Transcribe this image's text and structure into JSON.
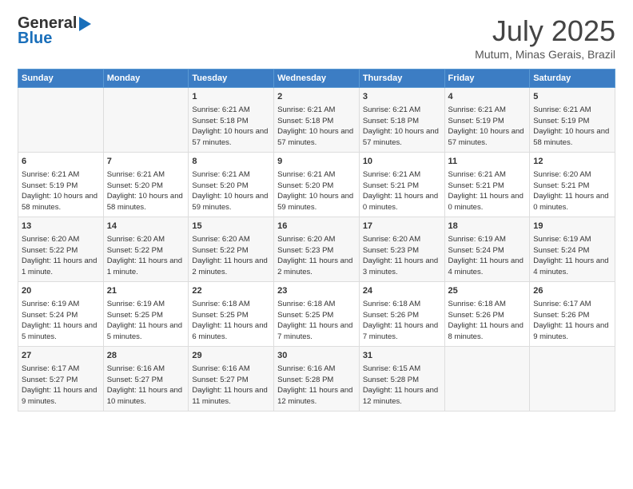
{
  "header": {
    "logo_general": "General",
    "logo_blue": "Blue",
    "month_year": "July 2025",
    "location": "Mutum, Minas Gerais, Brazil"
  },
  "days_of_week": [
    "Sunday",
    "Monday",
    "Tuesday",
    "Wednesday",
    "Thursday",
    "Friday",
    "Saturday"
  ],
  "weeks": [
    [
      {
        "day": "",
        "info": ""
      },
      {
        "day": "",
        "info": ""
      },
      {
        "day": "1",
        "info": "Sunrise: 6:21 AM\nSunset: 5:18 PM\nDaylight: 10 hours and 57 minutes."
      },
      {
        "day": "2",
        "info": "Sunrise: 6:21 AM\nSunset: 5:18 PM\nDaylight: 10 hours and 57 minutes."
      },
      {
        "day": "3",
        "info": "Sunrise: 6:21 AM\nSunset: 5:18 PM\nDaylight: 10 hours and 57 minutes."
      },
      {
        "day": "4",
        "info": "Sunrise: 6:21 AM\nSunset: 5:19 PM\nDaylight: 10 hours and 57 minutes."
      },
      {
        "day": "5",
        "info": "Sunrise: 6:21 AM\nSunset: 5:19 PM\nDaylight: 10 hours and 58 minutes."
      }
    ],
    [
      {
        "day": "6",
        "info": "Sunrise: 6:21 AM\nSunset: 5:19 PM\nDaylight: 10 hours and 58 minutes."
      },
      {
        "day": "7",
        "info": "Sunrise: 6:21 AM\nSunset: 5:20 PM\nDaylight: 10 hours and 58 minutes."
      },
      {
        "day": "8",
        "info": "Sunrise: 6:21 AM\nSunset: 5:20 PM\nDaylight: 10 hours and 59 minutes."
      },
      {
        "day": "9",
        "info": "Sunrise: 6:21 AM\nSunset: 5:20 PM\nDaylight: 10 hours and 59 minutes."
      },
      {
        "day": "10",
        "info": "Sunrise: 6:21 AM\nSunset: 5:21 PM\nDaylight: 11 hours and 0 minutes."
      },
      {
        "day": "11",
        "info": "Sunrise: 6:21 AM\nSunset: 5:21 PM\nDaylight: 11 hours and 0 minutes."
      },
      {
        "day": "12",
        "info": "Sunrise: 6:20 AM\nSunset: 5:21 PM\nDaylight: 11 hours and 0 minutes."
      }
    ],
    [
      {
        "day": "13",
        "info": "Sunrise: 6:20 AM\nSunset: 5:22 PM\nDaylight: 11 hours and 1 minute."
      },
      {
        "day": "14",
        "info": "Sunrise: 6:20 AM\nSunset: 5:22 PM\nDaylight: 11 hours and 1 minute."
      },
      {
        "day": "15",
        "info": "Sunrise: 6:20 AM\nSunset: 5:22 PM\nDaylight: 11 hours and 2 minutes."
      },
      {
        "day": "16",
        "info": "Sunrise: 6:20 AM\nSunset: 5:23 PM\nDaylight: 11 hours and 2 minutes."
      },
      {
        "day": "17",
        "info": "Sunrise: 6:20 AM\nSunset: 5:23 PM\nDaylight: 11 hours and 3 minutes."
      },
      {
        "day": "18",
        "info": "Sunrise: 6:19 AM\nSunset: 5:24 PM\nDaylight: 11 hours and 4 minutes."
      },
      {
        "day": "19",
        "info": "Sunrise: 6:19 AM\nSunset: 5:24 PM\nDaylight: 11 hours and 4 minutes."
      }
    ],
    [
      {
        "day": "20",
        "info": "Sunrise: 6:19 AM\nSunset: 5:24 PM\nDaylight: 11 hours and 5 minutes."
      },
      {
        "day": "21",
        "info": "Sunrise: 6:19 AM\nSunset: 5:25 PM\nDaylight: 11 hours and 5 minutes."
      },
      {
        "day": "22",
        "info": "Sunrise: 6:18 AM\nSunset: 5:25 PM\nDaylight: 11 hours and 6 minutes."
      },
      {
        "day": "23",
        "info": "Sunrise: 6:18 AM\nSunset: 5:25 PM\nDaylight: 11 hours and 7 minutes."
      },
      {
        "day": "24",
        "info": "Sunrise: 6:18 AM\nSunset: 5:26 PM\nDaylight: 11 hours and 7 minutes."
      },
      {
        "day": "25",
        "info": "Sunrise: 6:18 AM\nSunset: 5:26 PM\nDaylight: 11 hours and 8 minutes."
      },
      {
        "day": "26",
        "info": "Sunrise: 6:17 AM\nSunset: 5:26 PM\nDaylight: 11 hours and 9 minutes."
      }
    ],
    [
      {
        "day": "27",
        "info": "Sunrise: 6:17 AM\nSunset: 5:27 PM\nDaylight: 11 hours and 9 minutes."
      },
      {
        "day": "28",
        "info": "Sunrise: 6:16 AM\nSunset: 5:27 PM\nDaylight: 11 hours and 10 minutes."
      },
      {
        "day": "29",
        "info": "Sunrise: 6:16 AM\nSunset: 5:27 PM\nDaylight: 11 hours and 11 minutes."
      },
      {
        "day": "30",
        "info": "Sunrise: 6:16 AM\nSunset: 5:28 PM\nDaylight: 11 hours and 12 minutes."
      },
      {
        "day": "31",
        "info": "Sunrise: 6:15 AM\nSunset: 5:28 PM\nDaylight: 11 hours and 12 minutes."
      },
      {
        "day": "",
        "info": ""
      },
      {
        "day": "",
        "info": ""
      }
    ]
  ]
}
